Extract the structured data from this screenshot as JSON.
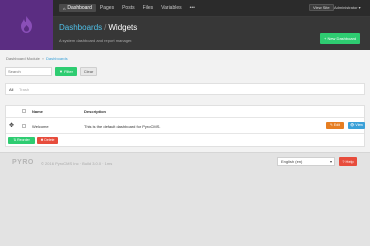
{
  "brand": {
    "logo_icon": "pyro-flame-icon",
    "color": "#5b2d82"
  },
  "nav": {
    "items": [
      {
        "label": "Dashboard",
        "icon": "home-icon"
      },
      {
        "label": "Pages"
      },
      {
        "label": "Posts"
      },
      {
        "label": "Files"
      },
      {
        "label": "Variables"
      },
      {
        "label": "•••"
      }
    ],
    "view_site": "View Site",
    "user": "Administrator ▾"
  },
  "header": {
    "module": "Dashboards",
    "separator": "/",
    "page": "Widgets",
    "subtitle": "A system dashboard and report manager.",
    "new_button": "+ New Dashboard"
  },
  "breadcrumb": {
    "items": [
      "Dashboard Module",
      "Dashboards"
    ],
    "separator": "»"
  },
  "filter": {
    "search_placeholder": "Search",
    "filter_button": "▼ Filter",
    "clear_button": "Clear"
  },
  "tabs": [
    "All",
    "Trash"
  ],
  "table": {
    "headers": [
      "Name",
      "Description"
    ],
    "rows": [
      {
        "name": "Welcome",
        "description": "This is the default dashboard for PyroCMS.",
        "edit": "✎ Edit",
        "view": "👁 View"
      }
    ],
    "reorder_button": "⇅ Reorder",
    "delete_button": "✖ Delete"
  },
  "footer": {
    "logo": "PYRO",
    "text": "© 2016 PyroCMS Inc  ·  Build 3.0.0  ·  1ms",
    "language": "English (en)",
    "help": "? Help"
  },
  "colors": {
    "accent_green": "#2ecc71",
    "edit_orange": "#e67e22",
    "view_blue": "#3aa0d8",
    "danger_red": "#e74c3c"
  }
}
